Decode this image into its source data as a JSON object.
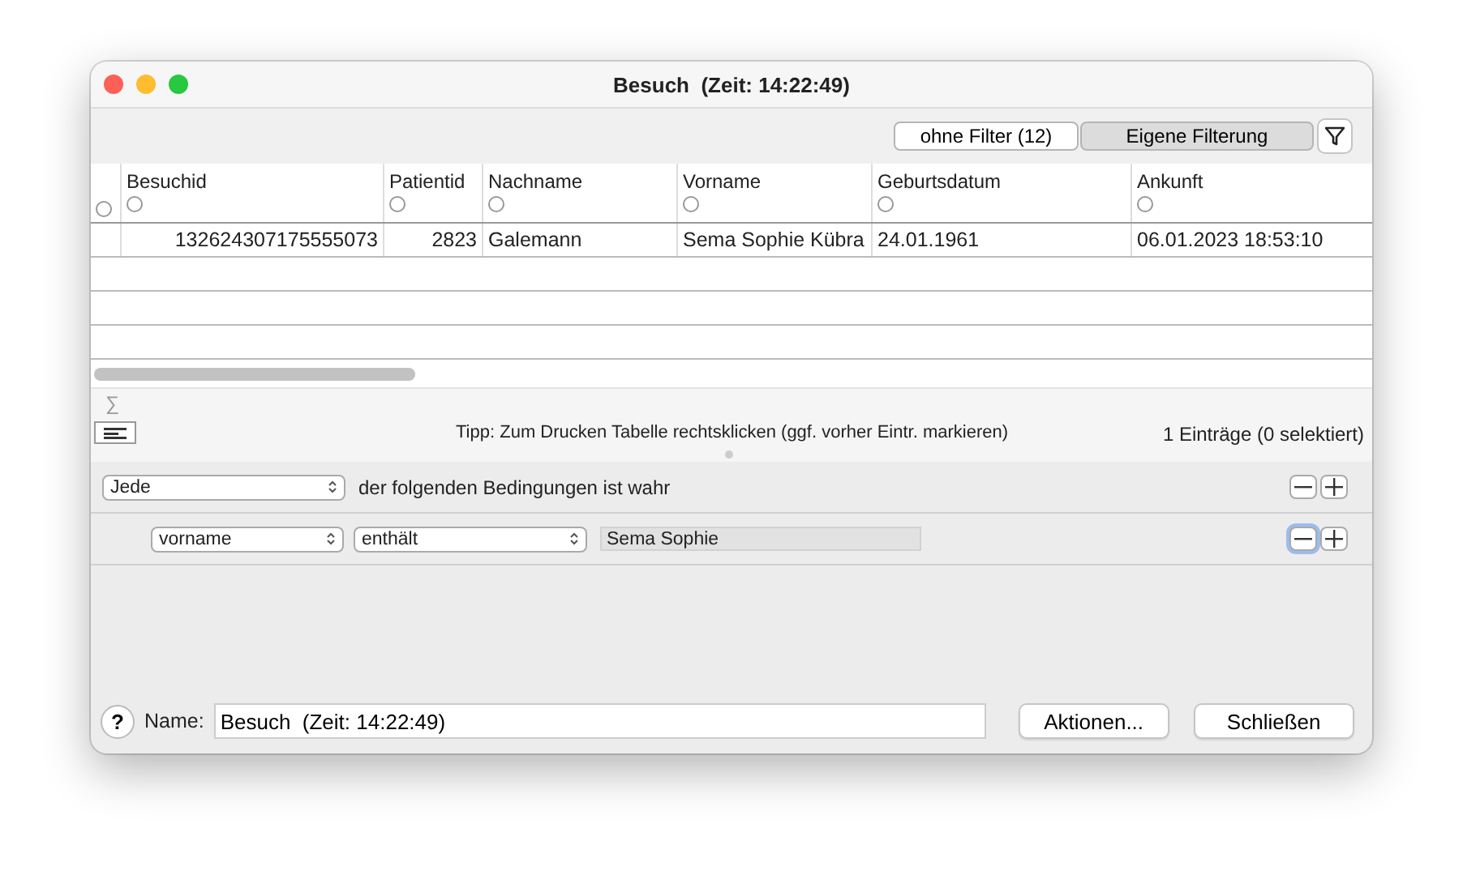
{
  "window": {
    "title": "Besuch  (Zeit: 14:22:49)"
  },
  "filter_buttons": [
    {
      "label": "ohne Filter (12)",
      "selected": false
    },
    {
      "label": "Eigene Filterung",
      "selected": true
    }
  ],
  "table": {
    "select_all_selected": false,
    "columns": [
      {
        "label": "Besuchid",
        "selected": false
      },
      {
        "label": "Patientid",
        "selected": false
      },
      {
        "label": "Nachname",
        "selected": false
      },
      {
        "label": "Vorname",
        "selected": false
      },
      {
        "label": "Geburtsdatum",
        "selected": false
      },
      {
        "label": "Ankunft",
        "selected": false
      }
    ],
    "rows": [
      {
        "cells": [
          "132624307175555073",
          "2823",
          "Galemann",
          "Sema Sophie Kübra",
          "24.01.1961",
          "06.01.2023 18:53:10"
        ]
      }
    ]
  },
  "tip": "Tipp: Zum Drucken Tabelle rechtsklicken (ggf. vorher Eintr. markieren)",
  "count": "1 Einträge (0 selektiert)",
  "sum_symbol": "∑",
  "rule": {
    "quantifier": "Jede",
    "text": "der folgenden Bedingungen ist wahr"
  },
  "conditions": [
    {
      "field": "vorname",
      "operator": "enthält",
      "value": "Sema Sophie"
    }
  ],
  "footer": {
    "help": "?",
    "name_label": "Name:",
    "name_value": "Besuch  (Zeit: 14:22:49)",
    "buttons": [
      "Aktionen...",
      "Schließen"
    ]
  }
}
